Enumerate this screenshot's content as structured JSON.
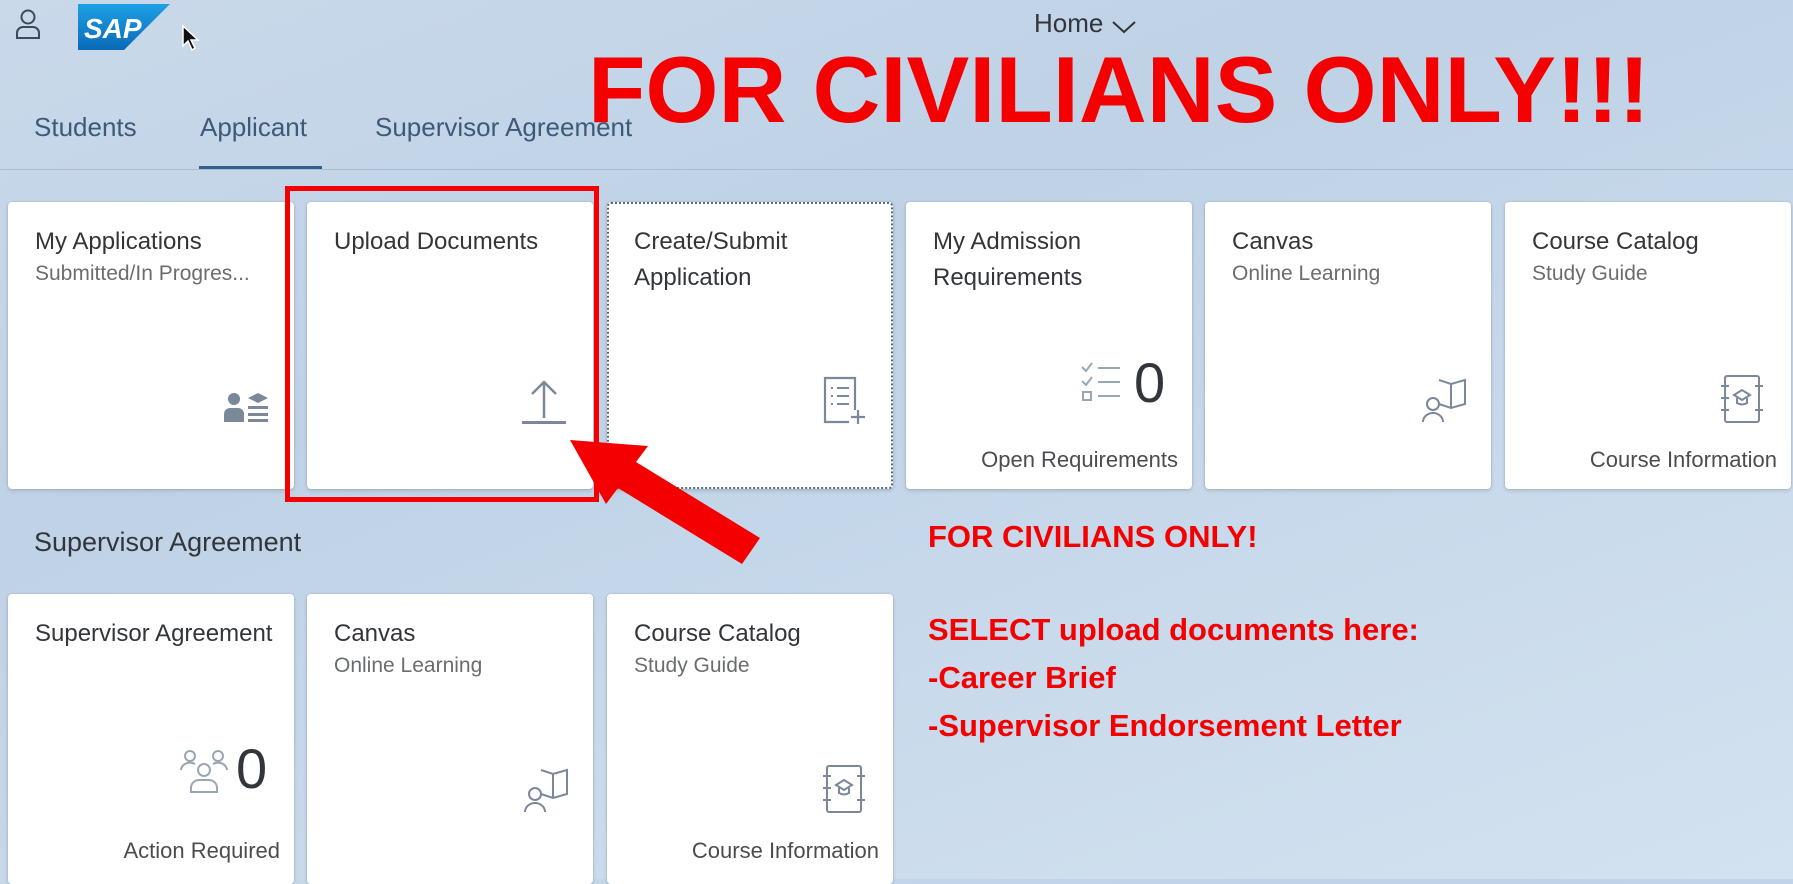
{
  "shell": {
    "home_title": "Home",
    "user_icon": "user-icon",
    "logo_text": "SAP"
  },
  "tabs": [
    {
      "label": "Students",
      "selected": false
    },
    {
      "label": "Applicant",
      "selected": true
    },
    {
      "label": "Supervisor Agreement",
      "selected": false
    }
  ],
  "applicant_tiles": [
    {
      "title": "My Applications",
      "subtitle": "Submitted/In Progres...",
      "icon": "student-profile-icon"
    },
    {
      "title": "Upload Documents",
      "subtitle": "",
      "icon": "upload-icon"
    },
    {
      "title": "Create/Submit Application",
      "subtitle": "",
      "icon": "create-form-icon"
    },
    {
      "title": "My Admission Requirements",
      "subtitle": "",
      "icon": "checklist-icon",
      "kpi": "0",
      "footer": "Open Requirements"
    },
    {
      "title": "Canvas",
      "subtitle": "Online Learning",
      "icon": "learning-icon"
    },
    {
      "title": "Course Catalog",
      "subtitle": "Study Guide",
      "icon": "course-book-icon",
      "footer": "Course Information"
    }
  ],
  "section": {
    "title": "Supervisor Agreement"
  },
  "supervisor_tiles": [
    {
      "title": "Supervisor Agreement",
      "subtitle": "",
      "icon": "group-icon",
      "kpi": "0",
      "footer": "Action Required"
    },
    {
      "title": "Canvas",
      "subtitle": "Online Learning",
      "icon": "learning-icon"
    },
    {
      "title": "Course Catalog",
      "subtitle": "Study Guide",
      "icon": "course-book-icon",
      "footer": "Course Information"
    }
  ],
  "annotations": {
    "banner": "FOR CIVILIANS ONLY!!!",
    "note_line1": "FOR CIVILIANS ONLY!",
    "note_line2": "SELECT upload documents here:",
    "note_line3": "-Career Brief",
    "note_line4": "-Supervisor Endorsement Letter",
    "color": "#f40000"
  }
}
